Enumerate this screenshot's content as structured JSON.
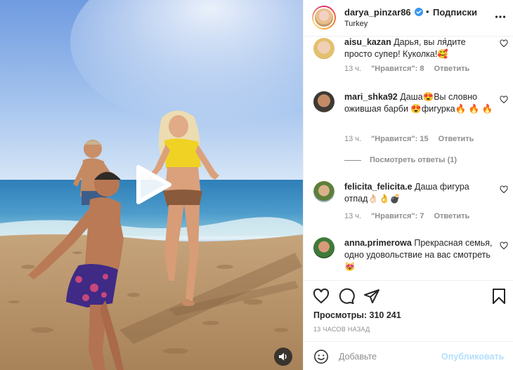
{
  "header": {
    "username": "darya_pinzar86",
    "separator": "•",
    "follow_label": "Подписки",
    "location": "Turkey"
  },
  "comments": [
    {
      "username": "aisu_kazan",
      "text": " Дарья, вы ля́дите просто супер! Куколка!🥰",
      "time": "13 ч.",
      "likes": "\"Нравится\": 8",
      "reply_label": "Ответить"
    },
    {
      "username": "mari_shka92",
      "text": " Даша😍Вы словно ожившая барби 😍фигурка🔥 🔥 🔥",
      "time": "13 ч.",
      "likes": "\"Нравится\": 15",
      "reply_label": "Ответить",
      "view_replies": "Посмотреть ответы (1)"
    },
    {
      "username": "felicita_felicita.e",
      "text": " Даша фигура отпад👌🏻👌💣",
      "time": "13 ч.",
      "likes": "\"Нравится\": 7",
      "reply_label": "Ответить"
    },
    {
      "username": "anna.primerowa",
      "text": " Прекрасная семья, одно удовольствие на вас смотреть😻",
      "time": "",
      "likes": "",
      "reply_label": ""
    }
  ],
  "stats": {
    "views": "Просмотры: 310 241",
    "time_ago": "13 часов назад"
  },
  "add_comment": {
    "placeholder": "Добавьте",
    "publish_label": "Опубликовать"
  },
  "colors": {
    "accent_disabled": "#b2dffc",
    "text_primary": "#262626",
    "text_secondary": "#8e8e8e",
    "verified": "#3897f0"
  },
  "icons": [
    "play-icon",
    "volume-icon",
    "verified-icon",
    "more-icon",
    "heart-icon",
    "comment-icon",
    "share-icon",
    "bookmark-icon",
    "emoji-icon"
  ]
}
